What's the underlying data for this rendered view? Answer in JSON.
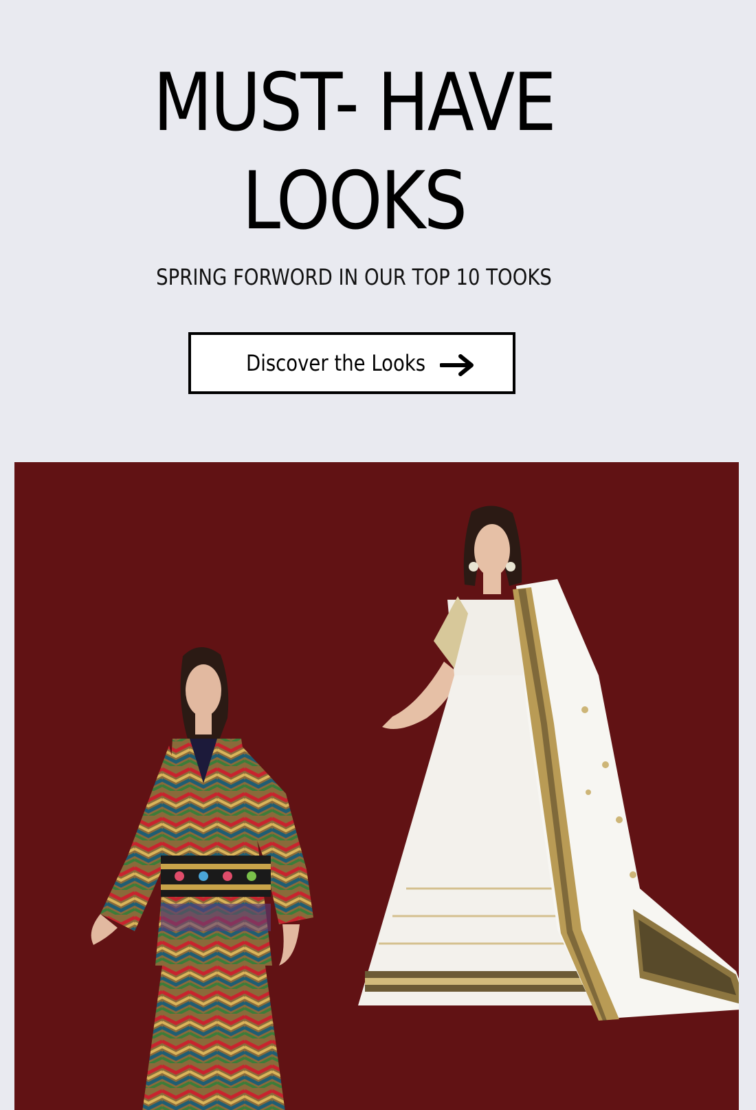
{
  "hero": {
    "title_line1": "MUST- HAVE",
    "title_line2": "LOOKS",
    "subtitle": "SPRING FORWORD IN OUR TOP 10 TOOKS"
  },
  "cta": {
    "label": "Discover the Looks",
    "icon": "arrow-right-icon"
  },
  "feature": {
    "background_color": "#611214",
    "images": [
      {
        "name": "model-left",
        "description_icon": "multicolor-chevron-kurta-set"
      },
      {
        "name": "model-right",
        "description_icon": "white-gold-lehenga-dupatta"
      }
    ]
  },
  "colors": {
    "page_background": "#e9eaf0",
    "panel_background": "#611214",
    "text": "#000000",
    "button_background": "#ffffff"
  }
}
